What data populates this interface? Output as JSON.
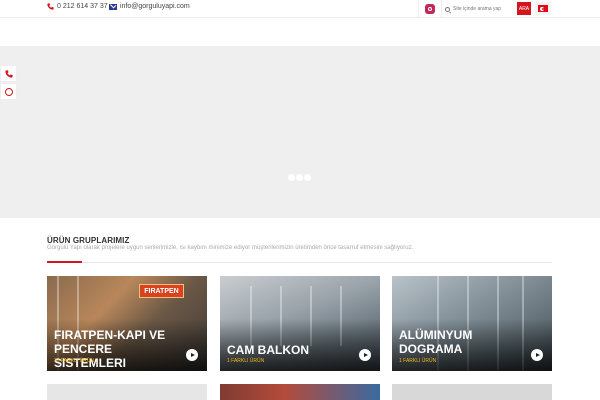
{
  "topbar": {
    "phone": "0 212 614 37 37",
    "email": "info@gorguluyapi.com",
    "search_placeholder": "Site içinde arama yap",
    "search_button": "ARA",
    "language_icon": "turkish-flag-icon",
    "social_icon": "instagram-icon"
  },
  "side_widget": {
    "items": [
      "phone-icon",
      "circle-icon"
    ]
  },
  "slider": {
    "loader": "loading-dots"
  },
  "section": {
    "title": "ÜRÜN GRUPLARIMIZ",
    "subtitle": "Görgülü Yapı olarak projelere uygun serilerimizle, ısı kaybını minimize ediyor müşterilerimizin üretimden önce tasarruf etmesini sağlıyoruz."
  },
  "cards": [
    {
      "title": "FIRATPEN-KAPI VE PENCERE SISTEMLERI",
      "count": "22 FARKLI ÜRÜN",
      "sign": "FIRATPEN"
    },
    {
      "title": "CAM BALKON",
      "count": "1 FARKLI ÜRÜN"
    },
    {
      "title": "ALÜMINYUM DOGRAMA",
      "count": "1 FARKLI ÜRÜN"
    }
  ],
  "colors": {
    "accent": "#d3161c",
    "count": "#f5b818",
    "slider_bg": "#efefef"
  }
}
